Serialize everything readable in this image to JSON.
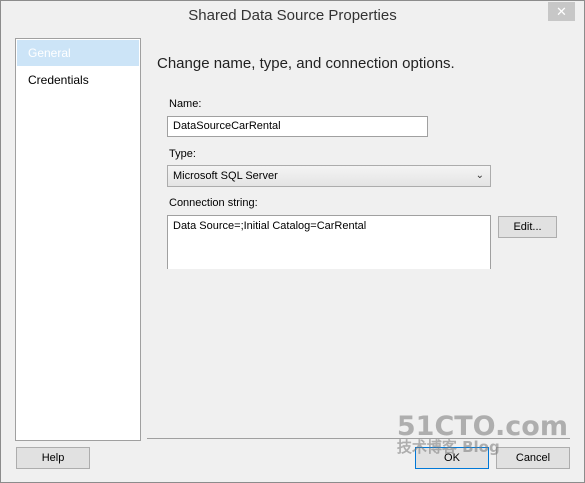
{
  "window": {
    "title": "Shared Data Source Properties"
  },
  "nav": {
    "items": [
      {
        "label": "General",
        "selected": true
      },
      {
        "label": "Credentials",
        "selected": false
      }
    ]
  },
  "main": {
    "heading": "Change name, type, and connection options.",
    "name_label": "Name:",
    "name_value": "DataSourceCarRental",
    "type_label": "Type:",
    "type_value": "Microsoft SQL Server",
    "conn_label": "Connection string:",
    "conn_value": "Data Source=;Initial Catalog=CarRental",
    "edit_button": "Edit..."
  },
  "footer": {
    "help_button": "Help",
    "ok_button": "OK",
    "cancel_button": "Cancel"
  },
  "watermark": {
    "line1": "51CTO.com",
    "line2": "技术博客 Blog"
  },
  "icons": {
    "close": "close-icon",
    "dropdown": "chevron-down-icon"
  }
}
